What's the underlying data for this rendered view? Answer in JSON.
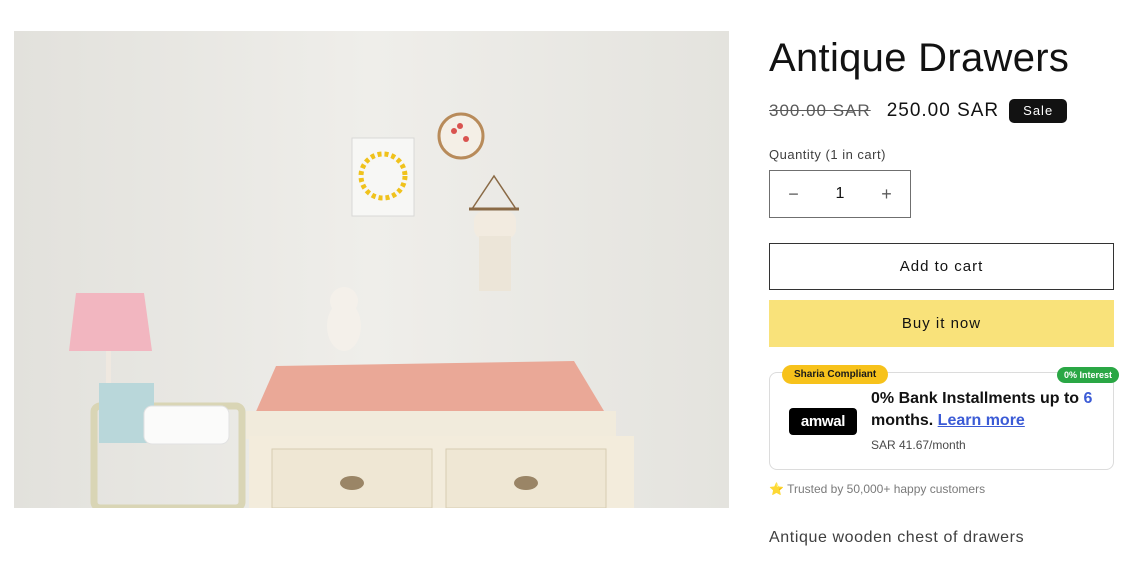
{
  "product": {
    "title": "Antique Drawers",
    "price_regular": "300.00 SAR",
    "price_sale": "250.00 SAR",
    "sale_badge": "Sale",
    "image_icon": "product-photo-nursery-drawers",
    "description": "Antique wooden chest of drawers"
  },
  "quantity": {
    "label": "Quantity (1 in cart)",
    "value": "1",
    "decrease_icon": "minus-icon",
    "increase_icon": "plus-icon",
    "decrease_symbol": "−",
    "increase_symbol": "+"
  },
  "buttons": {
    "add_to_cart": "Add to cart",
    "buy_now": "Buy it now"
  },
  "amwal": {
    "tag_sharia": "Sharia Compliant",
    "tag_interest": "0% Interest",
    "logo_text": "amwal",
    "headline_prefix": "0% Bank Installments up to",
    "months_number": "6",
    "months_word": "months.",
    "learn_more": "Learn more",
    "monthly": "SAR 41.67/month"
  },
  "trust": {
    "star_icon": "star-icon",
    "text": "Trusted by 50,000+ happy customers"
  },
  "colors": {
    "buy_now_bg": "#f9e27a",
    "sale_badge_bg": "#121212",
    "sharia_tag": "#f7c21b",
    "interest_tag": "#2aa745",
    "link": "#3b5bd6"
  }
}
